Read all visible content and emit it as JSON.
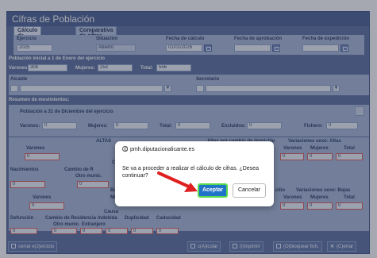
{
  "window": {
    "title": "Cifras de Población"
  },
  "tabs": [
    {
      "label": "Cálculo de cifras"
    },
    {
      "label": "Comparativa de cifras"
    }
  ],
  "header": {
    "ejercicio_label": "Ejercicio",
    "ejercicio": "2025",
    "situacion_label": "Situación",
    "situacion": "Abierto",
    "fecha_calculo_label": "Fecha de cálculo",
    "fecha_calculo": "01/01/2026",
    "fecha_aprobacion_label": "Fecha de aprobación",
    "fecha_aprobacion": "",
    "fecha_expedicion_label": "Fecha de expedición",
    "fecha_expedicion": ""
  },
  "poblacion_inicial": {
    "section": "Población inicial a 1 de Enero del ejercicio",
    "varones_label": "Varones:",
    "varones": "304",
    "mujeres_label": "Mujeres:",
    "mujeres": "252",
    "total_label": "Total:",
    "total": "556"
  },
  "alcalde": {
    "alcalde_label": "Alcalde",
    "secretario_label": "Secretario"
  },
  "resumen": {
    "section": "Resumen de movimientos:",
    "pob_label": "Población a 31 de Diciembre del ejercicio",
    "varones_label": "Varones:",
    "varones": "0",
    "mujeres_label": "Mujeres:",
    "mujeres": "0",
    "total_label": "Total:",
    "total": "0",
    "excluidos_label": "Excluidos:",
    "excluidos": "0",
    "fichero_label": "Fichero:",
    "fichero": "0"
  },
  "altas": {
    "title": "ALTAS",
    "varones_label": "Varones",
    "cambio_label": "Altas por cambio de domicilio",
    "tal_label": "tal",
    "var_sexo_label": "Variaciones sexo: Altas",
    "varones2_label": "Varones",
    "mujeres_label": "Mujeres",
    "total_label": "Total",
    "values": [
      "0",
      "0",
      "0",
      "0",
      "0"
    ]
  },
  "causas_altas": {
    "cau_label": "Cau",
    "nacimientos_label": "Nacimientos",
    "cambio_label": "Cambio de R",
    "otro_label": "Otro munic.",
    "values": [
      "0",
      "0"
    ]
  },
  "bajas": {
    "title": "BAJ",
    "varones_label": "Varones",
    "mujeres_label": "Muje",
    "cilio_label": "cilio",
    "var_sexo_label": "Variaciones sexo: Bajas",
    "varones2_label": "Varones",
    "mujeres2_label": "Mujeres",
    "total_label": "Total",
    "values": [
      "0",
      "0",
      "0",
      "0"
    ]
  },
  "causas_bajas": {
    "title": "Causa",
    "defuncion_label": "Defunción",
    "cambio_label": "Cambio de Residencia",
    "otro_label": "Otro munic.",
    "extranjero_label": "Extranjero",
    "indebida_label": "Indebida",
    "duplicidad_label": "Duplicidad",
    "caducidad_label": "Caducidad",
    "values": [
      "0",
      "0",
      "0",
      "0",
      "0",
      "0"
    ]
  },
  "dialog": {
    "site": "pmh.diputacionalicante.es",
    "message": "Se va a proceder a realizar el cálculo de cifras. ¿Desea continuar?",
    "ok": "Aceptar",
    "cancel": "Cancelar"
  },
  "bottom": {
    "cerrar_ejercicio": "cerrar e(J)ercicio",
    "calcular": "c(A)lcular",
    "imprimir": "(I)mprimir",
    "bloquear": "(O)bloquear fich.",
    "cerrar": "(C)errar"
  },
  "colors": {
    "accent": "#1f73c9",
    "window": "#5a6f9e",
    "panel": "#aab9d8",
    "highlight": "#56d94c",
    "arrow": "#e02020"
  }
}
